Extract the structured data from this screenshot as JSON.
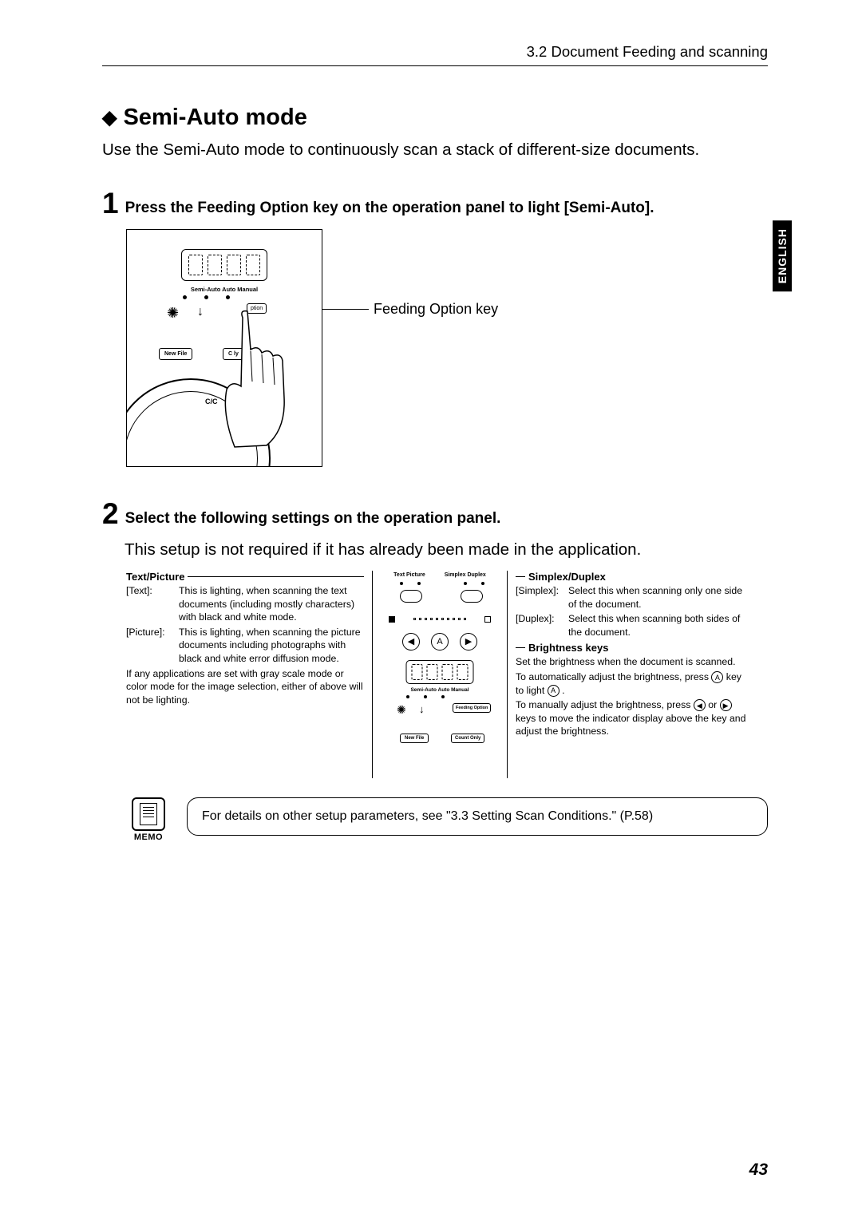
{
  "header": {
    "section_ref": "3.2   Document Feeding and scanning"
  },
  "language_tab": "ENGLISH",
  "title": {
    "bullet": "◆",
    "text": "Semi-Auto mode"
  },
  "intro": "Use the Semi-Auto mode to continuously scan a stack of different-size documents.",
  "steps": {
    "s1": {
      "num": "1",
      "text": "Press the Feeding Option key on the operation panel to light [Semi-Auto]."
    },
    "s2": {
      "num": "2",
      "text": "Select the following settings on the operation panel.",
      "body": "This setup is not required if it has already been made in the application."
    }
  },
  "figure1": {
    "mode_labels": "Semi-Auto Auto   Manual",
    "feeding_option_btn": "ption",
    "new_file_btn": "New File",
    "count_only_btn": "C         ly",
    "cc_label": "C/C",
    "callout": "Feeding Option key"
  },
  "settings": {
    "left": {
      "heading": "Text/Picture",
      "text_label": "[Text]:",
      "text_desc": "This is lighting, when scanning the text documents (including mostly characters) with black and white mode.",
      "picture_label": "[Picture]:",
      "picture_desc": "This is lighting, when scanning the picture documents including photographs with black and white error diffusion mode.",
      "note": "If any applications are set with gray scale mode or color mode for the image selection, either of above will not be lighting."
    },
    "center": {
      "top_labels_left": "Text    Picture",
      "top_labels_right": "Simplex Duplex",
      "ctrl_left": "◀",
      "ctrl_mid": "A",
      "ctrl_right": "▶",
      "mode_labels": "Semi-Auto Auto   Manual",
      "feeding_option": "Feeding Option",
      "new_file": "New File",
      "count_only": "Count Only"
    },
    "right": {
      "sd_heading": "Simplex/Duplex",
      "simplex_label": "[Simplex]:",
      "simplex_desc": "Select this when scanning only one side of the document.",
      "duplex_label": "[Duplex]:",
      "duplex_desc": "Select this when scanning both sides of the document.",
      "bk_heading": "Brightness keys",
      "bk_line1": "Set the brightness when the document is scanned.",
      "bk_line2a": "To automatically adjust the brightness, press ",
      "bk_line2b": " key to light ",
      "bk_line2c": " .",
      "bk_line3a": "To manually adjust the brightness, press ",
      "bk_line3b": " or ",
      "bk_line3c": " keys to move the indicator display above the key and adjust the brightness.",
      "key_A": "A",
      "key_left": "◀",
      "key_right": "▶"
    }
  },
  "memo": {
    "label": "MEMO",
    "text": "For details on other setup parameters, see \"3.3 Setting Scan Conditions.\" (P.58)"
  },
  "page_number": "43"
}
